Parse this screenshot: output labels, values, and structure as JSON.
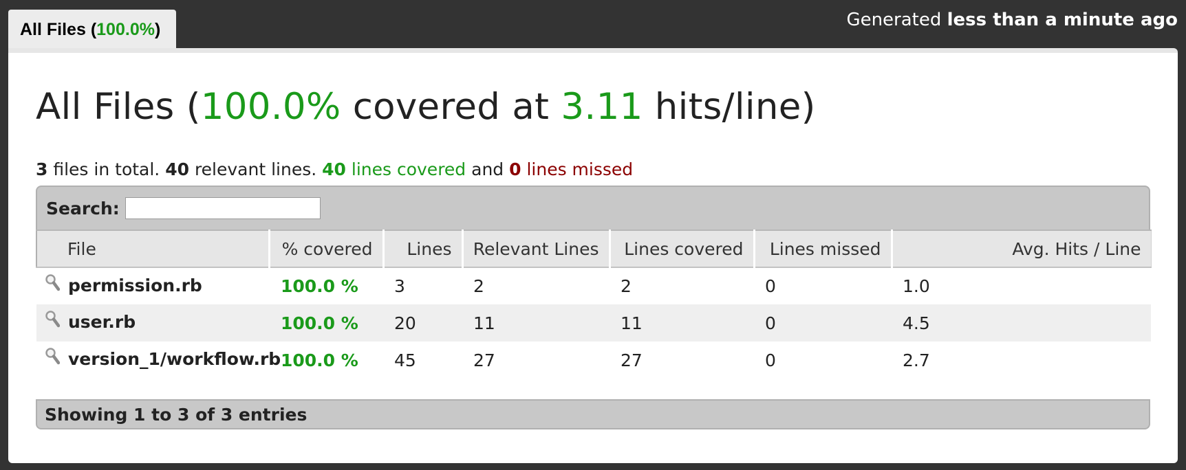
{
  "tab": {
    "label": "All Files",
    "percent": "100.0%"
  },
  "generated": {
    "prefix": "Generated",
    "time": "less than a minute ago"
  },
  "heading": {
    "prefix": "All Files (",
    "percent": "100.0%",
    "middle": " covered at ",
    "hits": "3.11",
    "suffix": " hits/line)"
  },
  "summary": {
    "files": "3",
    "files_text": " files in total. ",
    "relevant": "40",
    "relevant_text": " relevant lines. ",
    "covered": "40",
    "covered_text": " lines covered",
    "and_text": " and ",
    "missed": "0",
    "missed_text": " lines missed"
  },
  "search": {
    "label": "Search:",
    "value": ""
  },
  "table": {
    "columns": [
      "File",
      "% covered",
      "Lines",
      "Relevant Lines",
      "Lines covered",
      "Lines missed",
      "Avg. Hits / Line"
    ],
    "rows": [
      {
        "file": "permission.rb",
        "covered": "100.0 %",
        "lines": "3",
        "relevant": "2",
        "lines_covered": "2",
        "missed": "0",
        "avg": "1.0"
      },
      {
        "file": "user.rb",
        "covered": "100.0 %",
        "lines": "20",
        "relevant": "11",
        "lines_covered": "11",
        "missed": "0",
        "avg": "4.5"
      },
      {
        "file": "version_1/workflow.rb",
        "covered": "100.0 %",
        "lines": "45",
        "relevant": "27",
        "lines_covered": "27",
        "missed": "0",
        "avg": "2.7"
      }
    ]
  },
  "footer": {
    "info": "Showing 1 to 3 of 3 entries"
  },
  "colors": {
    "covered": "#1a9a1a",
    "missed": "#8b0000",
    "background": "#333333"
  },
  "icons": {
    "file_row": "magnifier-icon"
  }
}
